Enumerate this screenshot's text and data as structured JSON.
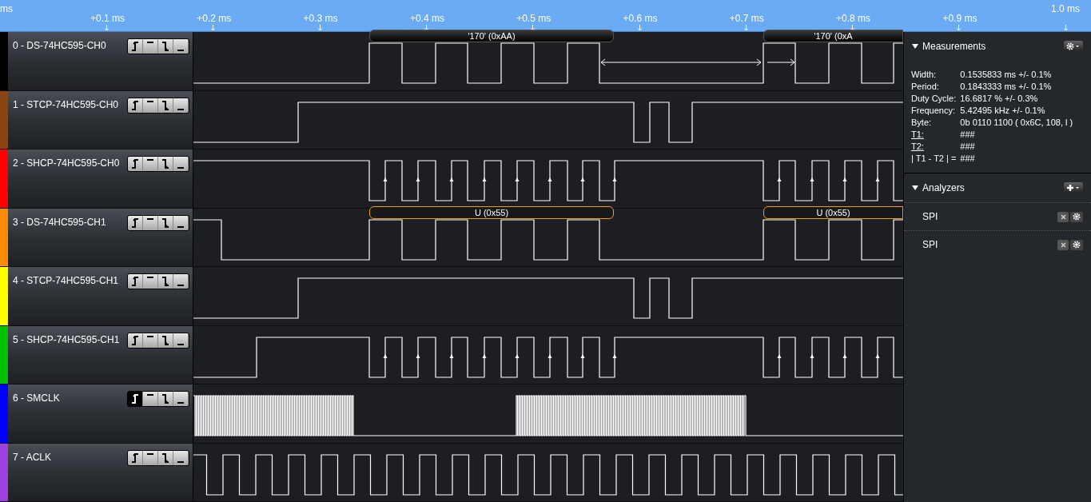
{
  "time_axis": {
    "unit": "ms",
    "end_label": "1.0 ms",
    "ticks": [
      "+0.1 ms",
      "+0.2 ms",
      "+0.3 ms",
      "+0.4 ms",
      "+0.5 ms",
      "+0.6 ms",
      "+0.7 ms",
      "+0.8 ms",
      "+0.9 ms"
    ]
  },
  "channels": [
    {
      "label": "0 - DS-74HC595-CH0",
      "color": "#000000",
      "triggers": [
        {
          "kind": "rising",
          "selected": false
        },
        {
          "kind": "high",
          "selected": false
        },
        {
          "kind": "falling",
          "selected": false
        },
        {
          "kind": "low",
          "selected": false
        }
      ],
      "decoded": [
        "'170' (0xAA)",
        "'170' (0xA"
      ]
    },
    {
      "label": "1 - STCP-74HC595-CH0",
      "color": "#8b4513",
      "triggers": [
        {
          "kind": "rising",
          "selected": false
        },
        {
          "kind": "high",
          "selected": false
        },
        {
          "kind": "falling",
          "selected": false
        },
        {
          "kind": "low",
          "selected": false
        }
      ]
    },
    {
      "label": "2 - SHCP-74HC595-CH0",
      "color": "#ff0000",
      "triggers": [
        {
          "kind": "rising",
          "selected": false
        },
        {
          "kind": "high",
          "selected": false
        },
        {
          "kind": "falling",
          "selected": false
        },
        {
          "kind": "low",
          "selected": false
        }
      ]
    },
    {
      "label": "3 - DS-74HC595-CH1",
      "color": "#ff8c00",
      "triggers": [
        {
          "kind": "rising",
          "selected": false
        },
        {
          "kind": "high",
          "selected": false
        },
        {
          "kind": "falling",
          "selected": false
        },
        {
          "kind": "low",
          "selected": false
        }
      ],
      "decoded": [
        "U (0x55)",
        "U (0x55)"
      ]
    },
    {
      "label": "4 - STCP-74HC595-CH1",
      "color": "#ffff00",
      "triggers": [
        {
          "kind": "rising",
          "selected": false
        },
        {
          "kind": "high",
          "selected": false
        },
        {
          "kind": "falling",
          "selected": false
        },
        {
          "kind": "low",
          "selected": false
        }
      ]
    },
    {
      "label": "5 - SHCP-74HC595-CH1",
      "color": "#00c000",
      "triggers": [
        {
          "kind": "rising",
          "selected": false
        },
        {
          "kind": "high",
          "selected": false
        },
        {
          "kind": "falling",
          "selected": false
        },
        {
          "kind": "low",
          "selected": false
        }
      ]
    },
    {
      "label": "6 - SMCLK",
      "color": "#0000ff",
      "triggers": [
        {
          "kind": "rising",
          "selected": true
        },
        {
          "kind": "high",
          "selected": false
        },
        {
          "kind": "falling",
          "selected": false
        },
        {
          "kind": "low",
          "selected": false
        }
      ]
    },
    {
      "label": "7 - ACLK",
      "color": "#a040e0",
      "triggers": [
        {
          "kind": "rising",
          "selected": false
        },
        {
          "kind": "high",
          "selected": false
        },
        {
          "kind": "falling",
          "selected": false
        },
        {
          "kind": "low",
          "selected": false
        }
      ]
    }
  ],
  "measurements": {
    "title": "Measurements",
    "expanded": true,
    "rows": [
      {
        "label": "Width:",
        "value": "0.1535833 ms +/- 0.1%",
        "kind": "plain"
      },
      {
        "label": "Period:",
        "value": "0.1843333 ms +/- 0.1%",
        "kind": "plain"
      },
      {
        "label": "Duty Cycle:",
        "value": "16.6817 % +/- 0.3%",
        "kind": "plain"
      },
      {
        "label": "Frequency:",
        "value": "5.42495 kHz +/- 0.1%",
        "kind": "plain"
      },
      {
        "label": "Byte:",
        "value": "0b  0110  1100 ( 0x6C, 108, l )",
        "kind": "plain"
      },
      {
        "label": "T1:",
        "value": "###",
        "kind": "link"
      },
      {
        "label": "T2:",
        "value": "###",
        "kind": "link"
      },
      {
        "label": "| T1 - T2 | =",
        "value": "###",
        "kind": "plain"
      }
    ]
  },
  "analyzers": {
    "title": "Analyzers",
    "expanded": true,
    "items": [
      {
        "name": "SPI"
      },
      {
        "name": "SPI"
      }
    ]
  }
}
